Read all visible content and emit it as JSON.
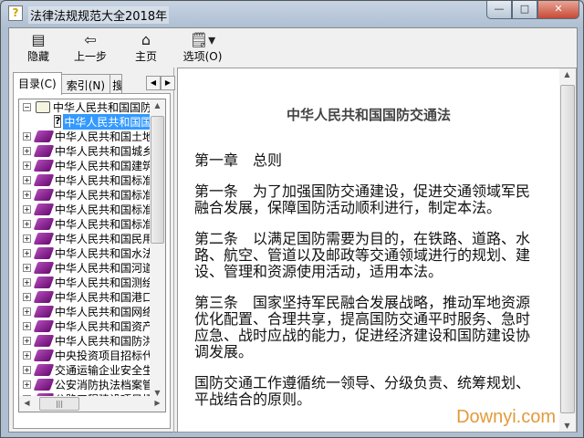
{
  "window": {
    "title": "法律法规规范大全2018年",
    "controls": {
      "minimize": "—",
      "maximize": "□",
      "close": "✕"
    }
  },
  "toolbar": {
    "hide": {
      "icon": "hide-pane-icon",
      "label": "隐藏"
    },
    "back": {
      "icon": "back-arrow-icon",
      "label": "上一步"
    },
    "home": {
      "icon": "home-icon",
      "label": "主页"
    },
    "options": {
      "icon": "options-icon",
      "label": "选项(O)"
    }
  },
  "tabs": [
    {
      "label": "目录(C)"
    },
    {
      "label": "索引(N)"
    },
    {
      "label": "搜"
    }
  ],
  "tree": {
    "items": [
      {
        "label": "中华人民共和国国防交通法",
        "expanded": true
      },
      {
        "label": "中华人民共和国国防交通法",
        "child": true,
        "selected": true
      },
      {
        "label": "中华人民共和国土地管理法"
      },
      {
        "label": "中华人民共和国城乡规划法"
      },
      {
        "label": "中华人民共和国建筑法"
      },
      {
        "label": "中华人民共和国标准化法"
      },
      {
        "label": "中华人民共和国标准化法"
      },
      {
        "label": "中华人民共和国标准化法"
      },
      {
        "label": "中华人民共和国标准化法"
      },
      {
        "label": "中华人民共和国民用航空法"
      },
      {
        "label": "中华人民共和国水法"
      },
      {
        "label": "中华人民共和国河道管理条例"
      },
      {
        "label": "中华人民共和国测绘法"
      },
      {
        "label": "中华人民共和国港口法"
      },
      {
        "label": "中华人民共和国网络安全法"
      },
      {
        "label": "中华人民共和国资产评估法"
      },
      {
        "label": "中华人民共和国防洪法"
      },
      {
        "label": "中央投资项目招标代理"
      },
      {
        "label": "交通运输企业安全生产"
      },
      {
        "label": "公安消防执法档案管理"
      },
      {
        "label": "公路工程建设项目招标"
      }
    ]
  },
  "document": {
    "title": "中华人民共和国国防交通法",
    "paragraphs": [
      "第一章　总则",
      "第一条　为了加强国防交通建设，促进交通领域军民融合发展，保障国防活动顺利进行，制定本法。",
      "第二条　以满足国防需要为目的，在铁路、道路、水路、航空、管道以及邮政等交通领域进行的规划、建设、管理和资源使用活动，适用本法。",
      "第三条　国家坚持军民融合发展战略，推动军地资源优化配置、合理共享，提高国防交通平时服务、急时应急、战时应战的能力，促进经济建设和国防建设协调发展。",
      "国防交通工作遵循统一领导、分级负责、统筹规划、平战结合的原则。"
    ]
  },
  "watermark": "Downyi.com"
}
